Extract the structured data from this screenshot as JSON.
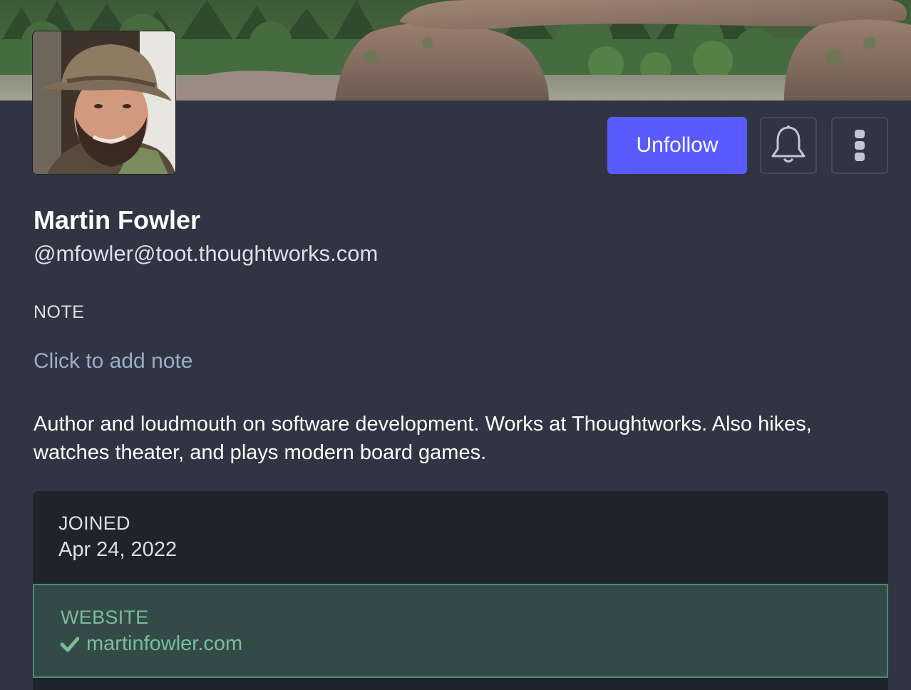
{
  "profile": {
    "display_name": "Martin Fowler",
    "handle": "@mfowler@toot.thoughtworks.com",
    "bio": "Author and loudmouth on software development. Works at Thoughtworks. Also hikes, watches theater, and plays modern board games."
  },
  "actions": {
    "unfollow_label": "Unfollow",
    "bell_icon": "bell-icon",
    "more_icon": "more-vertical-icon"
  },
  "note": {
    "label": "NOTE",
    "placeholder": "Click to add note"
  },
  "fields": {
    "joined": {
      "label": "JOINED",
      "value": "Apr 24, 2022"
    },
    "website": {
      "label": "WEBSITE",
      "value": "martinfowler.com",
      "verified_icon": "check-icon"
    }
  },
  "colors": {
    "background": "#313543",
    "accent": "#595aff",
    "verified": "#79bd9a",
    "fields_background": "#1f232b"
  }
}
